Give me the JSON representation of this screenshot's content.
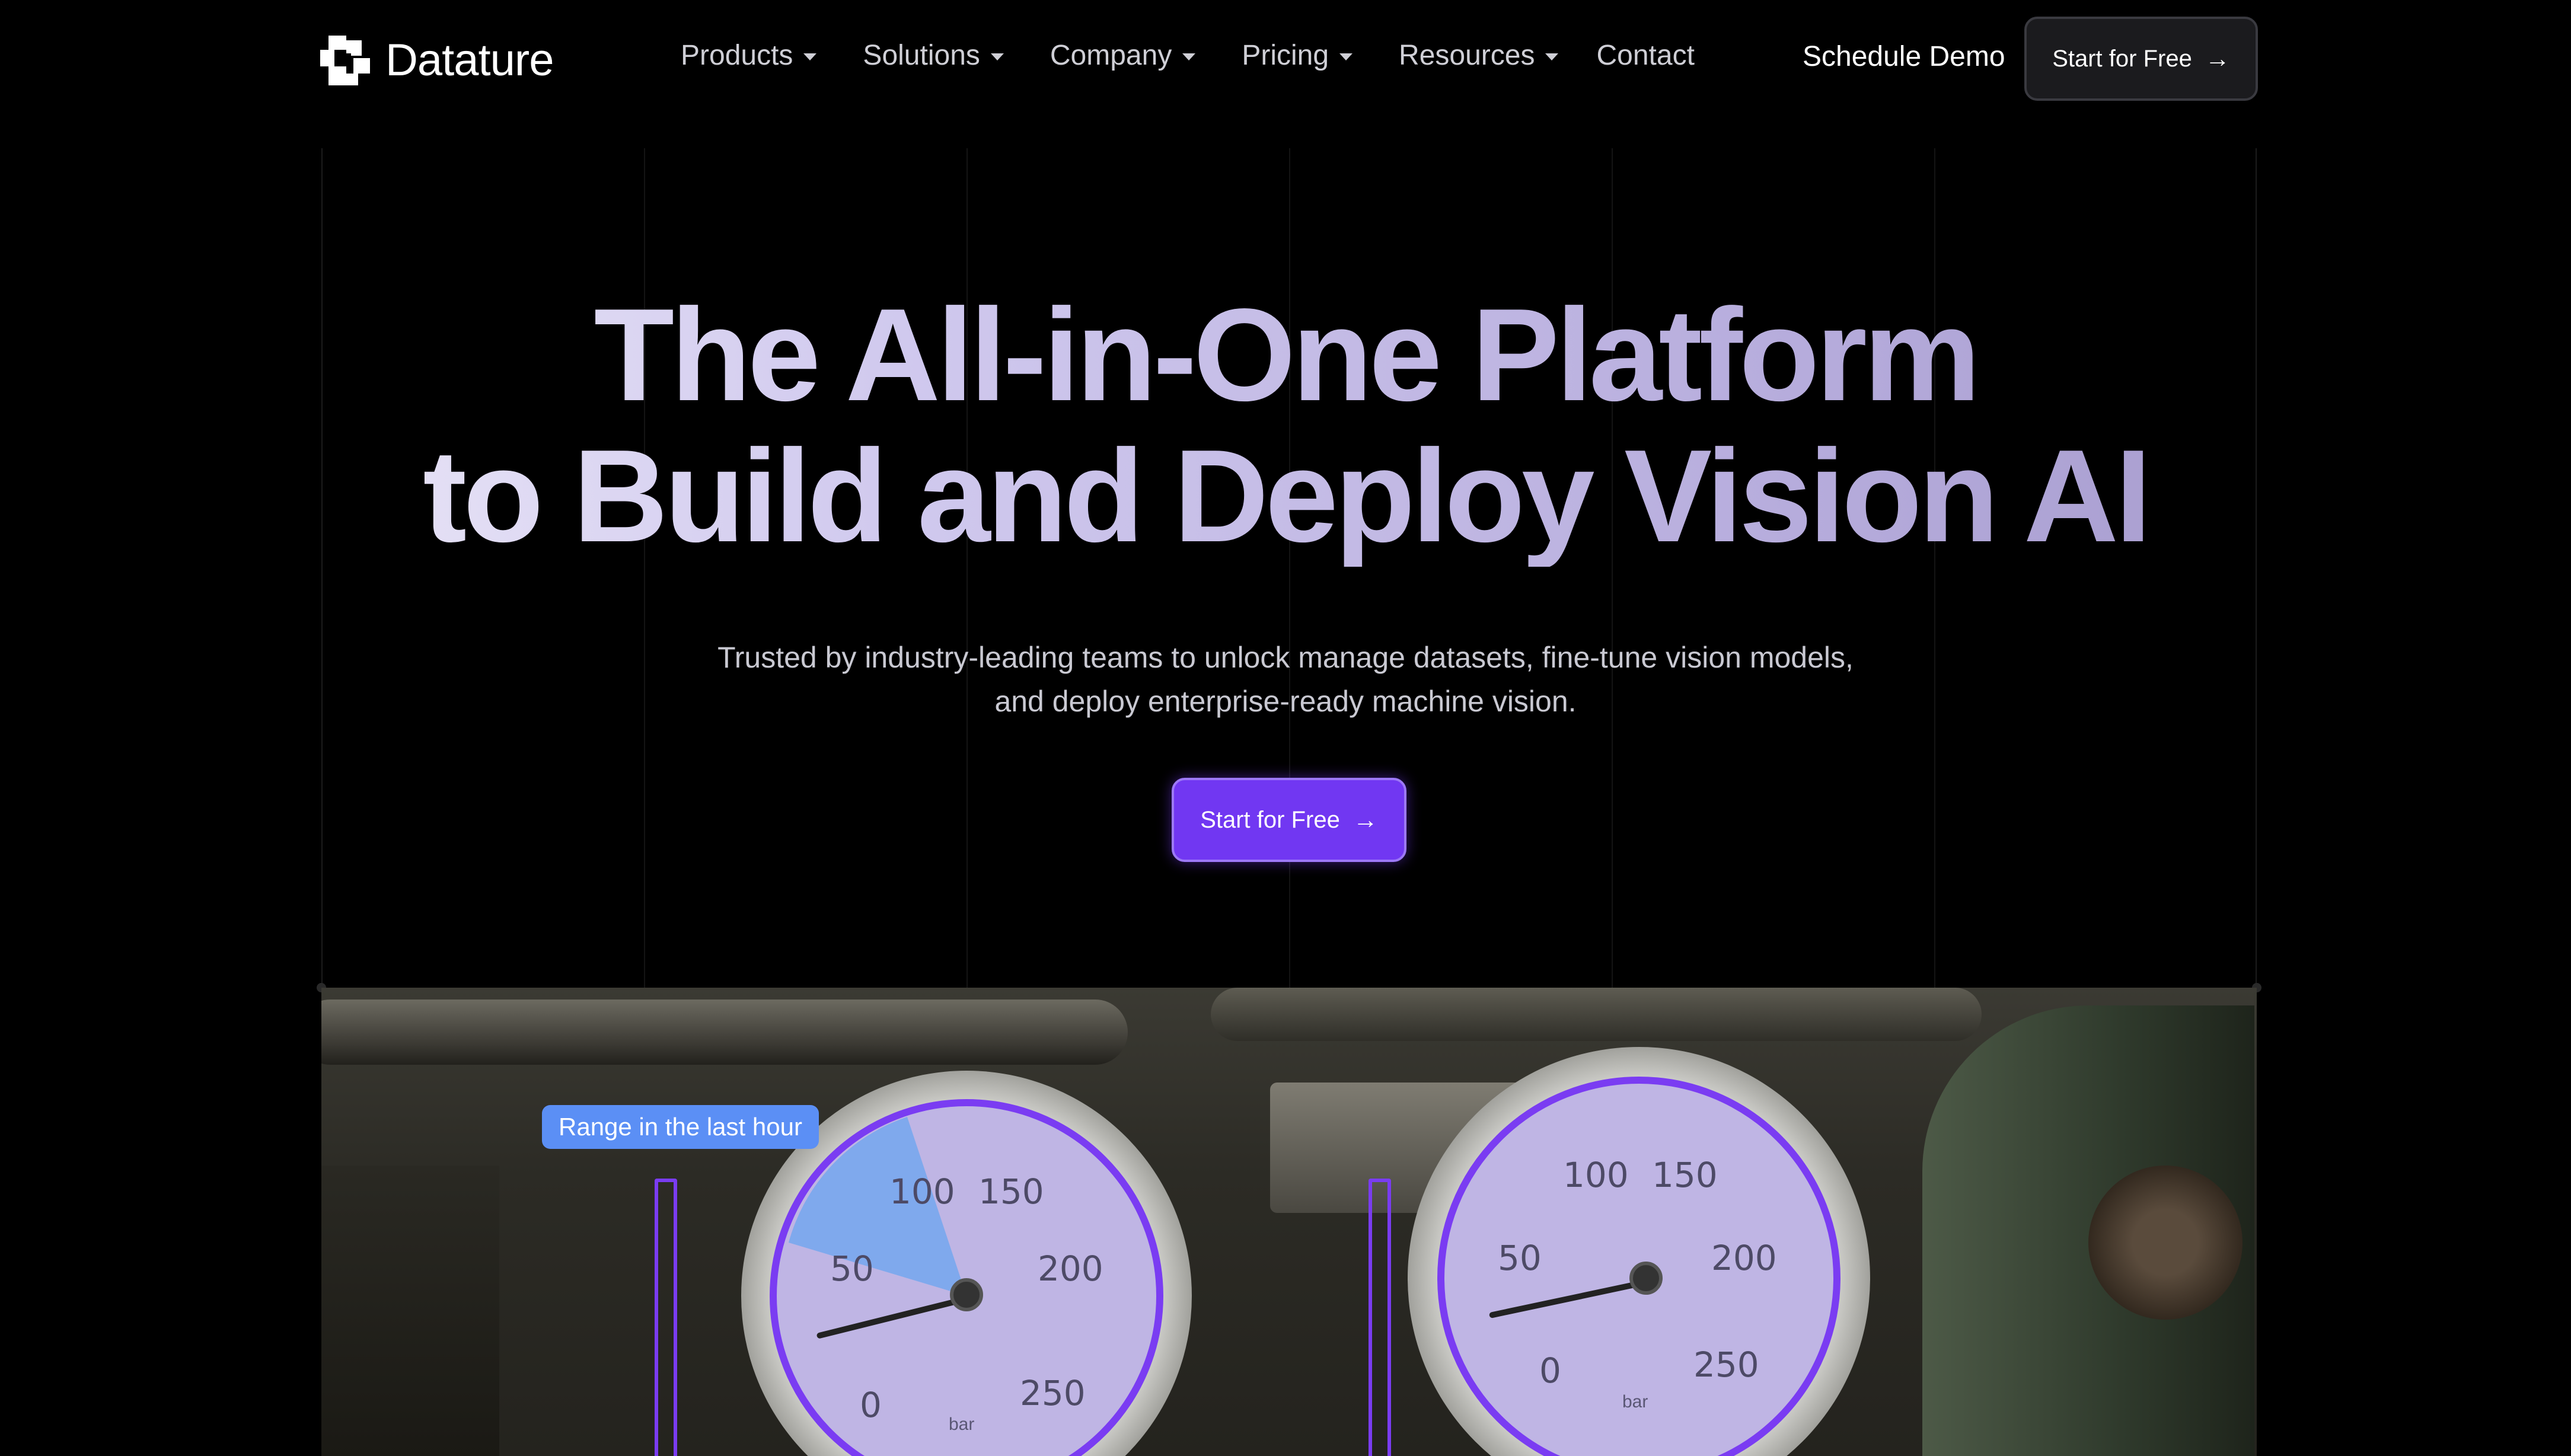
{
  "brand": {
    "name": "Datature"
  },
  "nav": {
    "items": [
      {
        "label": "Products",
        "dropdown": true
      },
      {
        "label": "Solutions",
        "dropdown": true
      },
      {
        "label": "Company",
        "dropdown": true
      },
      {
        "label": "Pricing",
        "dropdown": true
      },
      {
        "label": "Resources",
        "dropdown": true
      },
      {
        "label": "Contact",
        "dropdown": false
      }
    ],
    "demo_label": "Schedule Demo",
    "cta_label": "Start for Free"
  },
  "hero": {
    "title_line1": "The All-in-One Platform",
    "title_line2": "to Build and Deploy Vision AI",
    "subtitle": "Trusted by industry-leading teams to unlock manage datasets, fine-tune vision models,  and deploy enterprise-ready machine vision.",
    "cta_label": "Start for Free"
  },
  "demo_image": {
    "range_label": "Range in the last hour",
    "gauge_left": {
      "ticks": [
        "0",
        "50",
        "100",
        "150",
        "200",
        "250"
      ],
      "unit": "bar"
    },
    "gauge_right": {
      "ticks": [
        "0",
        "50",
        "100",
        "150",
        "200",
        "250"
      ],
      "unit": "bar"
    }
  },
  "colors": {
    "accent": "#7137f2",
    "range_tag": "#5b8ff5",
    "background": "#000000"
  }
}
